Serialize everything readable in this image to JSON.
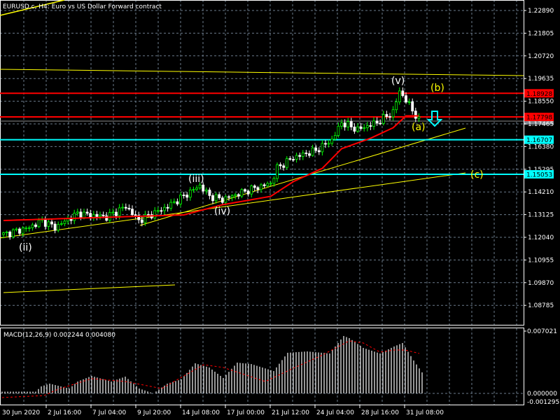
{
  "header": {
    "title": "EURUSD.c, H4:  Euro vs US Dollar Forward contract"
  },
  "colors": {
    "bull": "#00ff00",
    "bear": "#ffffff",
    "ma": "#ff0000",
    "grid": "#6b7b8c",
    "resistance": "#ff0000",
    "support": "#00ffff",
    "trend": "#ffff00"
  },
  "price_axis": {
    "ticks": [
      {
        "label": "1.22890",
        "value": 1.2289
      },
      {
        "label": "1.21805",
        "value": 1.21805
      },
      {
        "label": "1.20720",
        "value": 1.2072
      },
      {
        "label": "1.19635",
        "value": 1.19635
      },
      {
        "label": "1.18550",
        "value": 1.1855
      },
      {
        "label": "1.17465",
        "value": 1.17465
      },
      {
        "label": "1.16380",
        "value": 1.1638
      },
      {
        "label": "1.15295",
        "value": 1.15295
      },
      {
        "label": "1.14210",
        "value": 1.1421
      },
      {
        "label": "1.13125",
        "value": 1.13125
      },
      {
        "label": "1.12040",
        "value": 1.1204
      },
      {
        "label": "1.10955",
        "value": 1.10955
      },
      {
        "label": "1.09870",
        "value": 1.0987
      },
      {
        "label": "1.08785",
        "value": 1.08785
      }
    ],
    "levels": [
      {
        "label": "1.18928",
        "value": 1.18928,
        "color": "#ff0000",
        "text_color": "#000000"
      },
      {
        "label": "1.17798",
        "value": 1.17798,
        "color": "#ff0000",
        "text_color": "#000000"
      },
      {
        "label": "1.16707",
        "value": 1.16707,
        "color": "#00ffff",
        "text_color": "#000000"
      },
      {
        "label": "1.15053",
        "value": 1.15053,
        "color": "#00ffff",
        "text_color": "#000000"
      }
    ]
  },
  "waves": [
    {
      "label": "(ii)",
      "color": "#ffffff"
    },
    {
      "label": "(iii)",
      "color": "#ffffff"
    },
    {
      "label": "(iv)",
      "color": "#ffffff"
    },
    {
      "label": "(v)",
      "color": "#ffffff"
    },
    {
      "label": "(a)",
      "color": "#ffff00"
    },
    {
      "label": "(b)",
      "color": "#ffff00"
    },
    {
      "label": "(c)",
      "color": "#ffff00"
    }
  ],
  "time_axis": [
    "30 Jun 2020",
    "2 Jul 16:00",
    "7 Jul 04:00",
    "9 Jul 20:00",
    "14 Jul 08:00",
    "17 Jul 00:00",
    "21 Jul 12:00",
    "24 Jul 04:00",
    "28 Jul 16:00",
    "31 Jul 08:00"
  ],
  "macd": {
    "title": "MACD(12,26,9) 0.002244 0.004080",
    "axis_max": "0.007021",
    "axis_zero": "0.000000",
    "axis_min": "-0.001295"
  },
  "chart_data": {
    "type": "candlestick",
    "symbol": "EURUSD.c",
    "timeframe": "H4",
    "ylim": [
      1.0835,
      1.2335
    ],
    "price_path": [
      [
        0,
        1.12174
      ],
      [
        8,
        1.12509
      ],
      [
        12,
        1.12844
      ],
      [
        16,
        1.12509
      ],
      [
        23,
        1.13179
      ],
      [
        32,
        1.13011
      ],
      [
        38,
        1.13513
      ],
      [
        42,
        1.12844
      ],
      [
        51,
        1.13513
      ],
      [
        61,
        1.14518
      ],
      [
        64,
        1.14016
      ],
      [
        68,
        1.13848
      ],
      [
        77,
        1.1435
      ],
      [
        83,
        1.14619
      ],
      [
        85,
        1.15355
      ],
      [
        90,
        1.15858
      ],
      [
        97,
        1.16193
      ],
      [
        102,
        1.16695
      ],
      [
        105,
        1.17532
      ],
      [
        110,
        1.17197
      ],
      [
        116,
        1.17532
      ],
      [
        121,
        1.18034
      ],
      [
        123,
        1.19039
      ],
      [
        126,
        1.18369
      ],
      [
        129,
        1.17632
      ]
    ],
    "ma_path": [
      [
        0,
        1.12844
      ],
      [
        56,
        1.13112
      ],
      [
        68,
        1.13597
      ],
      [
        83,
        1.14
      ],
      [
        90,
        1.14703
      ],
      [
        99,
        1.15339
      ],
      [
        105,
        1.16277
      ],
      [
        114,
        1.16779
      ],
      [
        121,
        1.17281
      ],
      [
        125,
        1.1785
      ],
      [
        129,
        1.1785
      ]
    ],
    "macd_histogram": [
      [
        0,
        0.0002
      ],
      [
        12,
        0.0002
      ],
      [
        14,
        0.00079
      ],
      [
        17,
        0.0011
      ],
      [
        24,
        0.00055
      ],
      [
        27,
        0.00134
      ],
      [
        32,
        0.00197
      ],
      [
        39,
        0.00134
      ],
      [
        44,
        0.00189
      ],
      [
        49,
        0.00055
      ],
      [
        54,
        0.0
      ],
      [
        59,
        0.0011
      ],
      [
        64,
        0.00158
      ],
      [
        69,
        0.00339
      ],
      [
        74,
        0.00292
      ],
      [
        79,
        0.00174
      ],
      [
        84,
        0.00347
      ],
      [
        89,
        0.00331
      ],
      [
        97,
        0.00252
      ],
      [
        102,
        0.00458
      ],
      [
        109,
        0.00473
      ],
      [
        117,
        0.0045
      ],
      [
        122,
        0.00647
      ],
      [
        124,
        0.00623
      ],
      [
        129,
        0.00513
      ],
      [
        135,
        0.0045
      ],
      [
        140,
        0.00529
      ],
      [
        143,
        0.00568
      ],
      [
        147,
        0.00371
      ],
      [
        150,
        0.00237
      ]
    ],
    "macd_signal": [
      [
        0,
        -0.00047
      ],
      [
        15,
        -0.00024
      ],
      [
        20,
        0.00047
      ],
      [
        32,
        0.00166
      ],
      [
        44,
        0.00134
      ],
      [
        57,
        0.00055
      ],
      [
        72,
        0.00323
      ],
      [
        79,
        0.00292
      ],
      [
        94,
        0.00134
      ],
      [
        104,
        0.00284
      ],
      [
        114,
        0.00426
      ],
      [
        124,
        0.00592
      ],
      [
        129,
        0.00568
      ],
      [
        135,
        0.00465
      ],
      [
        140,
        0.00489
      ],
      [
        144,
        0.00489
      ],
      [
        149,
        0.0045
      ]
    ],
    "macd_ylim": [
      -0.001295,
      0.007021
    ]
  }
}
